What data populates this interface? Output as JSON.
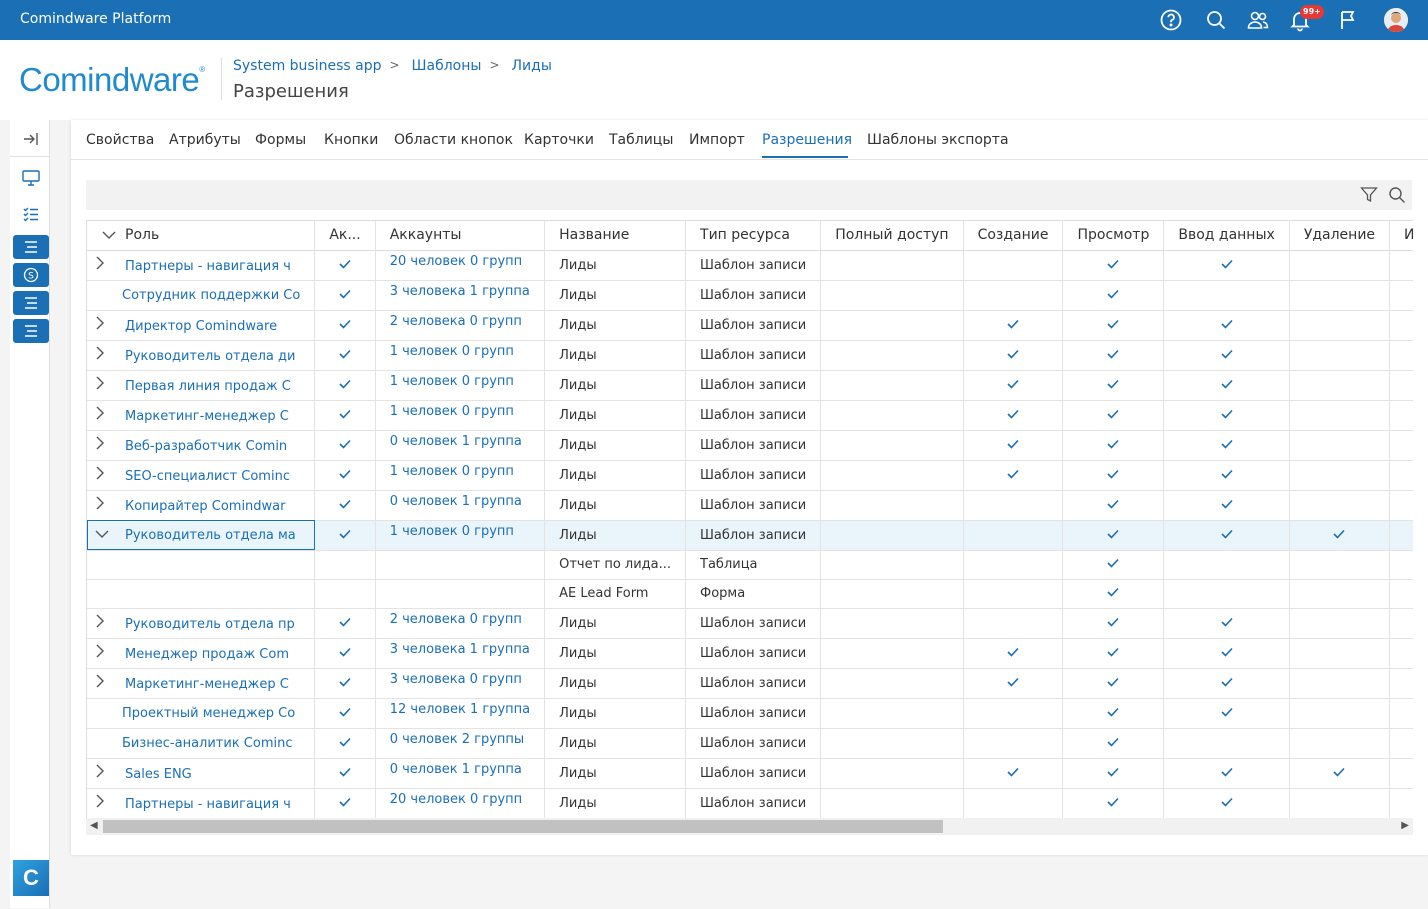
{
  "topbar": {
    "app_title": "Comindware Platform",
    "notification_badge": "99+",
    "icons": [
      "help-icon",
      "search-icon",
      "users-icon",
      "bell-icon",
      "flag-icon"
    ]
  },
  "logo": {
    "text": "Comindware",
    "mark": "®"
  },
  "breadcrumb": [
    "System business app",
    "Шаблоны",
    "Лиды"
  ],
  "page_title": "Разрешения",
  "tabs": [
    "Свойства",
    "Атрибуты",
    "Формы",
    "Кнопки",
    "Области кнопок",
    "Карточки",
    "Таблицы",
    "Импорт",
    "Разрешения",
    "Шаблоны экспорта"
  ],
  "active_tab": "Разрешения",
  "columns": [
    "Роль",
    "Ак...",
    "Аккаунты",
    "Название",
    "Тип ресурса",
    "Полный доступ",
    "Создание",
    "Просмотр",
    "Ввод данных",
    "Удаление",
    "И"
  ],
  "rows": [
    {
      "role": "Партнеры - навигация ч",
      "expander": "collapsed",
      "active": true,
      "accounts": "20 человек 0 групп",
      "name": "Лиды",
      "type": "Шаблон записи",
      "full": false,
      "create": false,
      "view": true,
      "edit": true,
      "delete": false
    },
    {
      "role": "Сотрудник поддержки Co",
      "expander": "none",
      "active": true,
      "accounts": "3 человека 1 группа",
      "name": "Лиды",
      "type": "Шаблон записи",
      "full": false,
      "create": false,
      "view": true,
      "edit": false,
      "delete": false
    },
    {
      "role": "Директор Comindware",
      "expander": "collapsed",
      "active": true,
      "accounts": "2 человека 0 групп",
      "name": "Лиды",
      "type": "Шаблон записи",
      "full": false,
      "create": true,
      "view": true,
      "edit": true,
      "delete": false
    },
    {
      "role": "Руководитель отдела ди",
      "expander": "collapsed",
      "active": true,
      "accounts": "1 человек 0 групп",
      "name": "Лиды",
      "type": "Шаблон записи",
      "full": false,
      "create": true,
      "view": true,
      "edit": true,
      "delete": false
    },
    {
      "role": "Первая линия продаж С",
      "expander": "collapsed",
      "active": true,
      "accounts": "1 человек 0 групп",
      "name": "Лиды",
      "type": "Шаблон записи",
      "full": false,
      "create": true,
      "view": true,
      "edit": true,
      "delete": false
    },
    {
      "role": "Маркетинг-менеджер С",
      "expander": "collapsed",
      "active": true,
      "accounts": "1 человек 0 групп",
      "name": "Лиды",
      "type": "Шаблон записи",
      "full": false,
      "create": true,
      "view": true,
      "edit": true,
      "delete": false
    },
    {
      "role": "Веб-разработчик Comin",
      "expander": "collapsed",
      "active": true,
      "accounts": "0 человек 1 группа",
      "name": "Лиды",
      "type": "Шаблон записи",
      "full": false,
      "create": true,
      "view": true,
      "edit": true,
      "delete": false
    },
    {
      "role": "SEO-специалист Cominc",
      "expander": "collapsed",
      "active": true,
      "accounts": "1 человек 0 групп",
      "name": "Лиды",
      "type": "Шаблон записи",
      "full": false,
      "create": true,
      "view": true,
      "edit": true,
      "delete": false
    },
    {
      "role": "Копирайтер Comindwar",
      "expander": "collapsed",
      "active": true,
      "accounts": "0 человек 1 группа",
      "name": "Лиды",
      "type": "Шаблон записи",
      "full": false,
      "create": false,
      "view": true,
      "edit": true,
      "delete": false
    },
    {
      "role": "Руководитель отдела ма",
      "expander": "expanded",
      "selected": true,
      "active": true,
      "accounts": "1 человек 0 групп",
      "name": "Лиды",
      "type": "Шаблон записи",
      "full": false,
      "create": false,
      "view": true,
      "edit": true,
      "delete": true
    },
    {
      "child": true,
      "role": "",
      "expander": "none",
      "active": false,
      "accounts": "",
      "name": "Отчет по лида...",
      "type": "Таблица",
      "full": false,
      "create": false,
      "view": true,
      "edit": false,
      "delete": false
    },
    {
      "child": true,
      "role": "",
      "expander": "none",
      "active": false,
      "accounts": "",
      "name": "AE Lead Form",
      "type": "Форма",
      "full": false,
      "create": false,
      "view": true,
      "edit": false,
      "delete": false
    },
    {
      "role": "Руководитель отдела пр",
      "expander": "collapsed",
      "active": true,
      "accounts": "2 человека 0 групп",
      "name": "Лиды",
      "type": "Шаблон записи",
      "full": false,
      "create": false,
      "view": true,
      "edit": true,
      "delete": false
    },
    {
      "role": "Менеджер продаж Com",
      "expander": "collapsed",
      "active": true,
      "accounts": "3 человека 1 группа",
      "name": "Лиды",
      "type": "Шаблон записи",
      "full": false,
      "create": true,
      "view": true,
      "edit": true,
      "delete": false
    },
    {
      "role": "Маркетинг-менеджер С",
      "expander": "collapsed",
      "active": true,
      "accounts": "3 человека 0 групп",
      "name": "Лиды",
      "type": "Шаблон записи",
      "full": false,
      "create": true,
      "view": true,
      "edit": true,
      "delete": false
    },
    {
      "role": "Проектный менеджер Co",
      "expander": "none",
      "active": true,
      "accounts": "12 человек 1 группа",
      "name": "Лиды",
      "type": "Шаблон записи",
      "full": false,
      "create": false,
      "view": true,
      "edit": true,
      "delete": false
    },
    {
      "role": "Бизнес-аналитик Cominc",
      "expander": "none",
      "active": true,
      "accounts": "0 человек 2 группы",
      "name": "Лиды",
      "type": "Шаблон записи",
      "full": false,
      "create": false,
      "view": true,
      "edit": false,
      "delete": false
    },
    {
      "role": "Sales ENG",
      "expander": "collapsed",
      "active": true,
      "accounts": "0 человек 1 группа",
      "name": "Лиды",
      "type": "Шаблон записи",
      "full": false,
      "create": true,
      "view": true,
      "edit": true,
      "delete": true
    },
    {
      "role": "Партнеры - навигация ч",
      "expander": "collapsed",
      "active": true,
      "accounts": "20 человек 0 групп",
      "name": "Лиды",
      "type": "Шаблон записи",
      "full": false,
      "create": false,
      "view": true,
      "edit": true,
      "delete": false
    }
  ],
  "colors": {
    "accent": "#1a6fb5",
    "topbar": "#1a6fb5",
    "selected_row": "#eaf4fb"
  }
}
